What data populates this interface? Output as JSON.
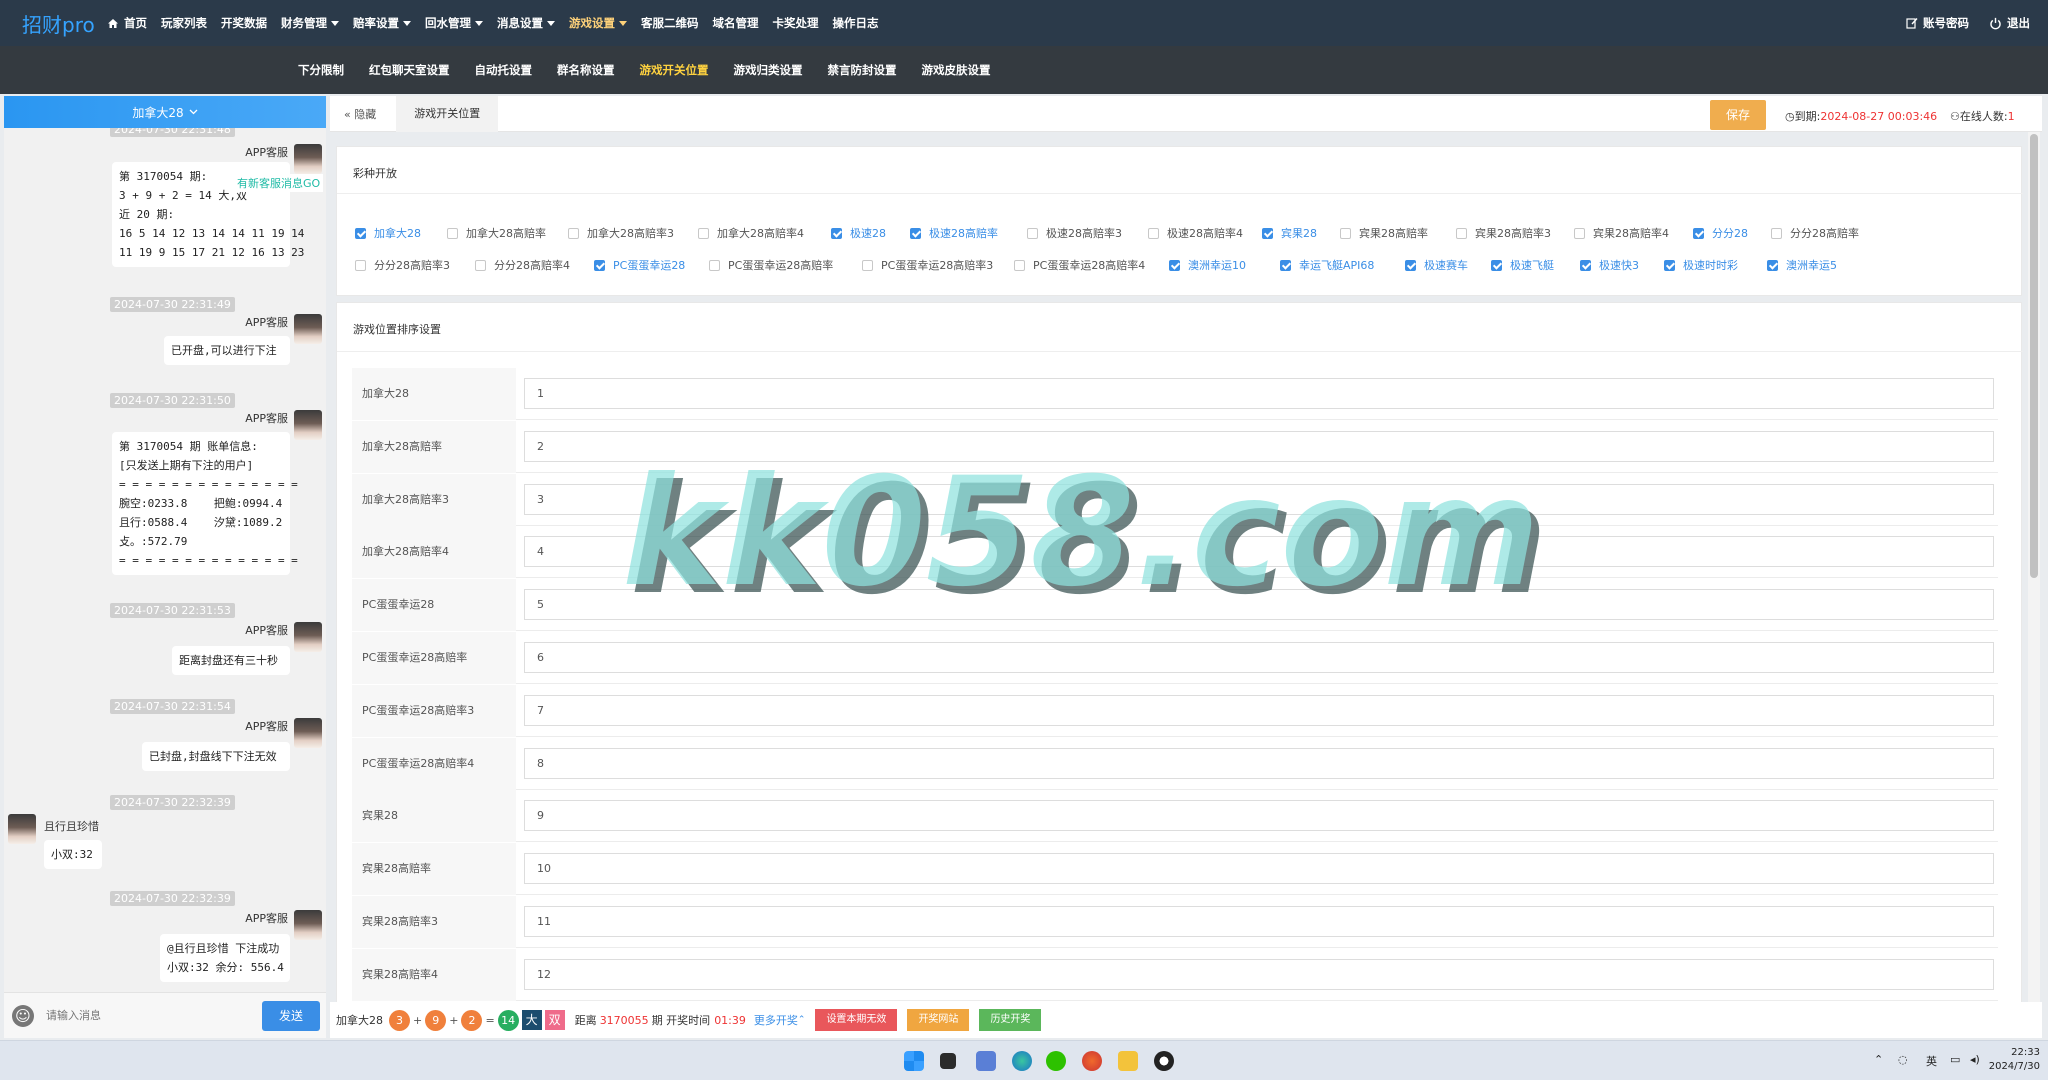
{
  "app": {
    "logo": "招财pro"
  },
  "topnav": [
    {
      "label": "首页",
      "dropdown": false,
      "active": false,
      "icon": "home-icon"
    },
    {
      "label": "玩家列表",
      "dropdown": false,
      "active": false
    },
    {
      "label": "开奖数据",
      "dropdown": false,
      "active": false
    },
    {
      "label": "财务管理",
      "dropdown": true,
      "active": false
    },
    {
      "label": "赔率设置",
      "dropdown": true,
      "active": false
    },
    {
      "label": "回水管理",
      "dropdown": true,
      "active": false
    },
    {
      "label": "消息设置",
      "dropdown": true,
      "active": false
    },
    {
      "label": "游戏设置",
      "dropdown": true,
      "active": true
    },
    {
      "label": "客服二维码",
      "dropdown": false,
      "active": false
    },
    {
      "label": "域名管理",
      "dropdown": false,
      "active": false
    },
    {
      "label": "卡奖处理",
      "dropdown": false,
      "active": false
    },
    {
      "label": "操作日志",
      "dropdown": false,
      "active": false
    }
  ],
  "topright": {
    "account": "账号密码",
    "logout": "退出"
  },
  "subnav": [
    {
      "label": "下分限制",
      "active": false
    },
    {
      "label": "红包聊天室设置",
      "active": false
    },
    {
      "label": "自动托设置",
      "active": false
    },
    {
      "label": "群名称设置",
      "active": false
    },
    {
      "label": "游戏开关位置",
      "active": true
    },
    {
      "label": "游戏归类设置",
      "active": false
    },
    {
      "label": "禁言防封设置",
      "active": false
    },
    {
      "label": "游戏皮肤设置",
      "active": false
    }
  ],
  "leftpanel": {
    "selector": "加拿大28",
    "messages": [
      {
        "ts": "2024-07-30 22:31:48",
        "sender": "APP客服",
        "side": "right",
        "text": "第 3170054 期:\n3 + 9 + 2 = 14 大,双\n近 20 期:\n16 5 14 12 13 14 14 11 19 14\n11 19 9 15 17 21 12 16 13 23"
      },
      {
        "ts": "2024-07-30 22:31:49",
        "sender": "APP客服",
        "side": "right",
        "text": "已开盘,可以进行下注"
      },
      {
        "ts": "2024-07-30 22:31:50",
        "sender": "APP客服",
        "side": "right",
        "text": "第 3170054 期 账单信息:\n[只发送上期有下注的用户]\n= = = = = = = = = = = = = =\n腕空:0233.8    把鲍:0994.4\n且行:0588.4    汐黛:1089.2\n攴。:572.79\n= = = = = = = = = = = = = ="
      },
      {
        "ts": "2024-07-30 22:31:53",
        "sender": "APP客服",
        "side": "right",
        "text": "距离封盘还有三十秒"
      },
      {
        "ts": "2024-07-30 22:31:54",
        "sender": "APP客服",
        "side": "right",
        "text": "已封盘,封盘线下下注无效"
      },
      {
        "ts": "2024-07-30 22:32:39",
        "sender": "且行且珍惜",
        "side": "left",
        "text": "小双:32"
      },
      {
        "ts": "2024-07-30 22:32:39",
        "sender": "APP客服",
        "side": "right",
        "text": "@且行且珍惜 下注成功\n小双:32 余分: 556.4"
      }
    ],
    "new_msg_tip": "有新客服消息GO",
    "input_placeholder": "请输入消息",
    "send_label": "发送"
  },
  "header": {
    "hide_label": "隐藏",
    "tab_label": "游戏开关位置",
    "save_label": "保存",
    "expire_label": "到期:",
    "expire_value": "2024-08-27 00:03:46",
    "online_label": "在线人数:",
    "online_value": "1"
  },
  "lottery_section": {
    "title": "彩种开放",
    "options": [
      {
        "label": "加拿大28",
        "checked": true
      },
      {
        "label": "加拿大28高赔率",
        "checked": false
      },
      {
        "label": "加拿大28高赔率3",
        "checked": false
      },
      {
        "label": "加拿大28高赔率4",
        "checked": false
      },
      {
        "label": "极速28",
        "checked": true
      },
      {
        "label": "极速28高赔率",
        "checked": true
      },
      {
        "label": "极速28高赔率3",
        "checked": false
      },
      {
        "label": "极速28高赔率4",
        "checked": false
      },
      {
        "label": "宾果28",
        "checked": true
      },
      {
        "label": "宾果28高赔率",
        "checked": false
      },
      {
        "label": "宾果28高赔率3",
        "checked": false
      },
      {
        "label": "宾果28高赔率4",
        "checked": false
      },
      {
        "label": "分分28",
        "checked": true
      },
      {
        "label": "分分28高赔率",
        "checked": false
      },
      {
        "label": "分分28高赔率3",
        "checked": false
      },
      {
        "label": "分分28高赔率4",
        "checked": false
      },
      {
        "label": "PC蛋蛋幸运28",
        "checked": true
      },
      {
        "label": "PC蛋蛋幸运28高赔率",
        "checked": false
      },
      {
        "label": "PC蛋蛋幸运28高赔率3",
        "checked": false
      },
      {
        "label": "PC蛋蛋幸运28高赔率4",
        "checked": false
      },
      {
        "label": "澳洲幸运10",
        "checked": true
      },
      {
        "label": "幸运飞艇API68",
        "checked": true
      },
      {
        "label": "极速赛车",
        "checked": true
      },
      {
        "label": "极速飞艇",
        "checked": true
      },
      {
        "label": "极速快3",
        "checked": true
      },
      {
        "label": "极速时时彩",
        "checked": true
      },
      {
        "label": "澳洲幸运5",
        "checked": true
      }
    ]
  },
  "order_section": {
    "title": "游戏位置排序设置",
    "rows": [
      {
        "label": "加拿大28",
        "value": "1"
      },
      {
        "label": "加拿大28高赔率",
        "value": "2"
      },
      {
        "label": "加拿大28高赔率3",
        "value": "3"
      },
      {
        "label": "加拿大28高赔率4",
        "value": "4"
      },
      {
        "label": "PC蛋蛋幸运28",
        "value": "5"
      },
      {
        "label": "PC蛋蛋幸运28高赔率",
        "value": "6"
      },
      {
        "label": "PC蛋蛋幸运28高赔率3",
        "value": "7"
      },
      {
        "label": "PC蛋蛋幸运28高赔率4",
        "value": "8"
      },
      {
        "label": "宾果28",
        "value": "9"
      },
      {
        "label": "宾果28高赔率",
        "value": "10"
      },
      {
        "label": "宾果28高赔率3",
        "value": "11"
      },
      {
        "label": "宾果28高赔率4",
        "value": "12"
      }
    ]
  },
  "bottombar": {
    "game": "加拿大28",
    "balls": [
      {
        "v": "3",
        "color": "#f0803c"
      },
      {
        "v": "9",
        "color": "#f0803c"
      },
      {
        "v": "2",
        "color": "#f0803c"
      }
    ],
    "sum": "14",
    "sum_color": "#27ae60",
    "big": "大",
    "big_color": "#1c4d6e",
    "parity": "双",
    "parity_color": "#ef6b8a",
    "dist_prefix": "距离",
    "issue": "3170055",
    "dist_mid": "期 开奖时间",
    "time": "01:39",
    "more": "更多开奖",
    "btn_invalid": "设置本期无效",
    "btn_site": "开奖网站",
    "btn_history": "历史开奖",
    "colors": {
      "invalid": "#e9575b",
      "site": "#f0a640",
      "history": "#5bb75b",
      "accent": "#3a8ee6",
      "red": "#e33"
    }
  },
  "watermark": "kk058.com",
  "taskbar": {
    "lang": "英",
    "time": "22:33",
    "date": "2024/7/30"
  }
}
